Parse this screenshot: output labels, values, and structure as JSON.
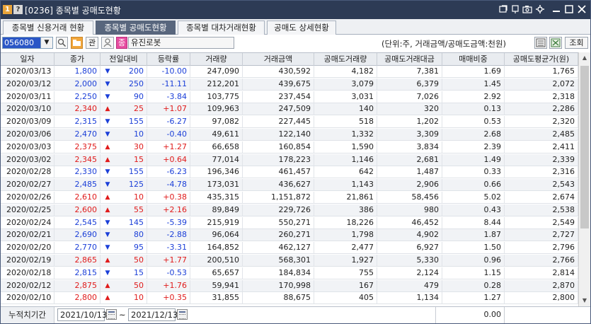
{
  "window": {
    "badge1": "1",
    "badge2": "?",
    "title": "[0236] 종목별 공매도현황",
    "controls": [
      "link-icon",
      "pin-icon",
      "capture-icon",
      "settings-icon",
      "minimize-icon",
      "maximize-icon",
      "close-icon"
    ]
  },
  "tabs": [
    {
      "label": "종목별 신용거래 현황",
      "active": false
    },
    {
      "label": "종목별 공매도현황",
      "active": true
    },
    {
      "label": "종목별 대차거래현황",
      "active": false
    },
    {
      "label": "공매도 상세현황",
      "active": false
    }
  ],
  "toolbar": {
    "code": "056080",
    "dropdown_glyph": "▼",
    "search_glyph": "⚲",
    "manage_label": "관",
    "jong_label": "종",
    "stock_name": "유진로봇",
    "unit_text": "(단위:주, 거래금액/공매도금액:천원)",
    "query_label": "조회"
  },
  "columns": [
    "일자",
    "종가",
    "전일대비",
    "등락률",
    "거래량",
    "거래금액",
    "공매도거래량",
    "공매도거래대금",
    "매매비중",
    "공매도평균가(원)"
  ],
  "rows": [
    {
      "date": "2020/03/13",
      "close": "1,800",
      "dir": "down",
      "diff": "200",
      "rate": "-10.00",
      "volume": "247,090",
      "amount": "430,592",
      "sVolume": "4,182",
      "sAmount": "7,381",
      "ratio": "1.69",
      "sAvg": "1,765"
    },
    {
      "date": "2020/03/12",
      "close": "2,000",
      "dir": "down",
      "diff": "250",
      "rate": "-11.11",
      "volume": "212,201",
      "amount": "439,675",
      "sVolume": "3,079",
      "sAmount": "6,379",
      "ratio": "1.45",
      "sAvg": "2,072"
    },
    {
      "date": "2020/03/11",
      "close": "2,250",
      "dir": "down",
      "diff": "90",
      "rate": "-3.84",
      "volume": "103,775",
      "amount": "237,454",
      "sVolume": "3,031",
      "sAmount": "7,026",
      "ratio": "2.92",
      "sAvg": "2,318"
    },
    {
      "date": "2020/03/10",
      "close": "2,340",
      "dir": "up",
      "diff": "25",
      "rate": "+1.07",
      "volume": "109,963",
      "amount": "247,509",
      "sVolume": "140",
      "sAmount": "320",
      "ratio": "0.13",
      "sAvg": "2,286"
    },
    {
      "date": "2020/03/09",
      "close": "2,315",
      "dir": "down",
      "diff": "155",
      "rate": "-6.27",
      "volume": "97,082",
      "amount": "227,445",
      "sVolume": "518",
      "sAmount": "1,202",
      "ratio": "0.53",
      "sAvg": "2,320"
    },
    {
      "date": "2020/03/06",
      "close": "2,470",
      "dir": "down",
      "diff": "10",
      "rate": "-0.40",
      "volume": "49,611",
      "amount": "122,140",
      "sVolume": "1,332",
      "sAmount": "3,309",
      "ratio": "2.68",
      "sAvg": "2,485"
    },
    {
      "date": "2020/03/03",
      "close": "2,375",
      "dir": "up",
      "diff": "30",
      "rate": "+1.27",
      "volume": "66,658",
      "amount": "160,854",
      "sVolume": "1,590",
      "sAmount": "3,834",
      "ratio": "2.39",
      "sAvg": "2,411"
    },
    {
      "date": "2020/03/02",
      "close": "2,345",
      "dir": "up",
      "diff": "15",
      "rate": "+0.64",
      "volume": "77,014",
      "amount": "178,223",
      "sVolume": "1,146",
      "sAmount": "2,681",
      "ratio": "1.49",
      "sAvg": "2,339"
    },
    {
      "date": "2020/02/28",
      "close": "2,330",
      "dir": "down",
      "diff": "155",
      "rate": "-6.23",
      "volume": "196,346",
      "amount": "461,457",
      "sVolume": "642",
      "sAmount": "1,487",
      "ratio": "0.33",
      "sAvg": "2,316"
    },
    {
      "date": "2020/02/27",
      "close": "2,485",
      "dir": "down",
      "diff": "125",
      "rate": "-4.78",
      "volume": "173,031",
      "amount": "436,627",
      "sVolume": "1,143",
      "sAmount": "2,906",
      "ratio": "0.66",
      "sAvg": "2,543"
    },
    {
      "date": "2020/02/26",
      "close": "2,610",
      "dir": "up",
      "diff": "10",
      "rate": "+0.38",
      "volume": "435,315",
      "amount": "1,151,872",
      "sVolume": "21,861",
      "sAmount": "58,456",
      "ratio": "5.02",
      "sAvg": "2,674"
    },
    {
      "date": "2020/02/25",
      "close": "2,600",
      "dir": "up",
      "diff": "55",
      "rate": "+2.16",
      "volume": "89,849",
      "amount": "229,726",
      "sVolume": "386",
      "sAmount": "980",
      "ratio": "0.43",
      "sAvg": "2,538"
    },
    {
      "date": "2020/02/24",
      "close": "2,545",
      "dir": "down",
      "diff": "145",
      "rate": "-5.39",
      "volume": "215,919",
      "amount": "550,271",
      "sVolume": "18,226",
      "sAmount": "46,452",
      "ratio": "8.44",
      "sAvg": "2,549"
    },
    {
      "date": "2020/02/21",
      "close": "2,690",
      "dir": "down",
      "diff": "80",
      "rate": "-2.88",
      "volume": "96,064",
      "amount": "260,271",
      "sVolume": "1,798",
      "sAmount": "4,902",
      "ratio": "1.87",
      "sAvg": "2,727"
    },
    {
      "date": "2020/02/20",
      "close": "2,770",
      "dir": "down",
      "diff": "95",
      "rate": "-3.31",
      "volume": "164,852",
      "amount": "462,127",
      "sVolume": "2,477",
      "sAmount": "6,927",
      "ratio": "1.50",
      "sAvg": "2,796"
    },
    {
      "date": "2020/02/19",
      "close": "2,865",
      "dir": "up",
      "diff": "50",
      "rate": "+1.77",
      "volume": "200,510",
      "amount": "568,301",
      "sVolume": "1,927",
      "sAmount": "5,330",
      "ratio": "0.96",
      "sAvg": "2,766"
    },
    {
      "date": "2020/02/18",
      "close": "2,815",
      "dir": "down",
      "diff": "15",
      "rate": "-0.53",
      "volume": "65,657",
      "amount": "184,834",
      "sVolume": "755",
      "sAmount": "2,124",
      "ratio": "1.15",
      "sAvg": "2,814"
    },
    {
      "date": "2020/02/12",
      "close": "2,875",
      "dir": "up",
      "diff": "50",
      "rate": "+1.76",
      "volume": "59,941",
      "amount": "170,998",
      "sVolume": "167",
      "sAmount": "479",
      "ratio": "0.28",
      "sAvg": "2,870"
    },
    {
      "date": "2020/02/10",
      "close": "2,800",
      "dir": "up",
      "diff": "10",
      "rate": "+0.35",
      "volume": "31,855",
      "amount": "88,675",
      "sVolume": "405",
      "sAmount": "1,134",
      "ratio": "1.27",
      "sAvg": "2,800"
    }
  ],
  "footer": {
    "label": "누적치기간",
    "from": "2021/10/13",
    "tilde": "~",
    "to": "2021/12/13",
    "ratio": "0.00"
  },
  "scroll": {
    "up_glyph": "▲",
    "down_glyph": "▼"
  },
  "colors": {
    "up": "#e01b1b",
    "down": "#1b3fd8",
    "titlebar": "#2d3b55",
    "active_tab": "#58667d",
    "code_field": "#2a56c6"
  }
}
